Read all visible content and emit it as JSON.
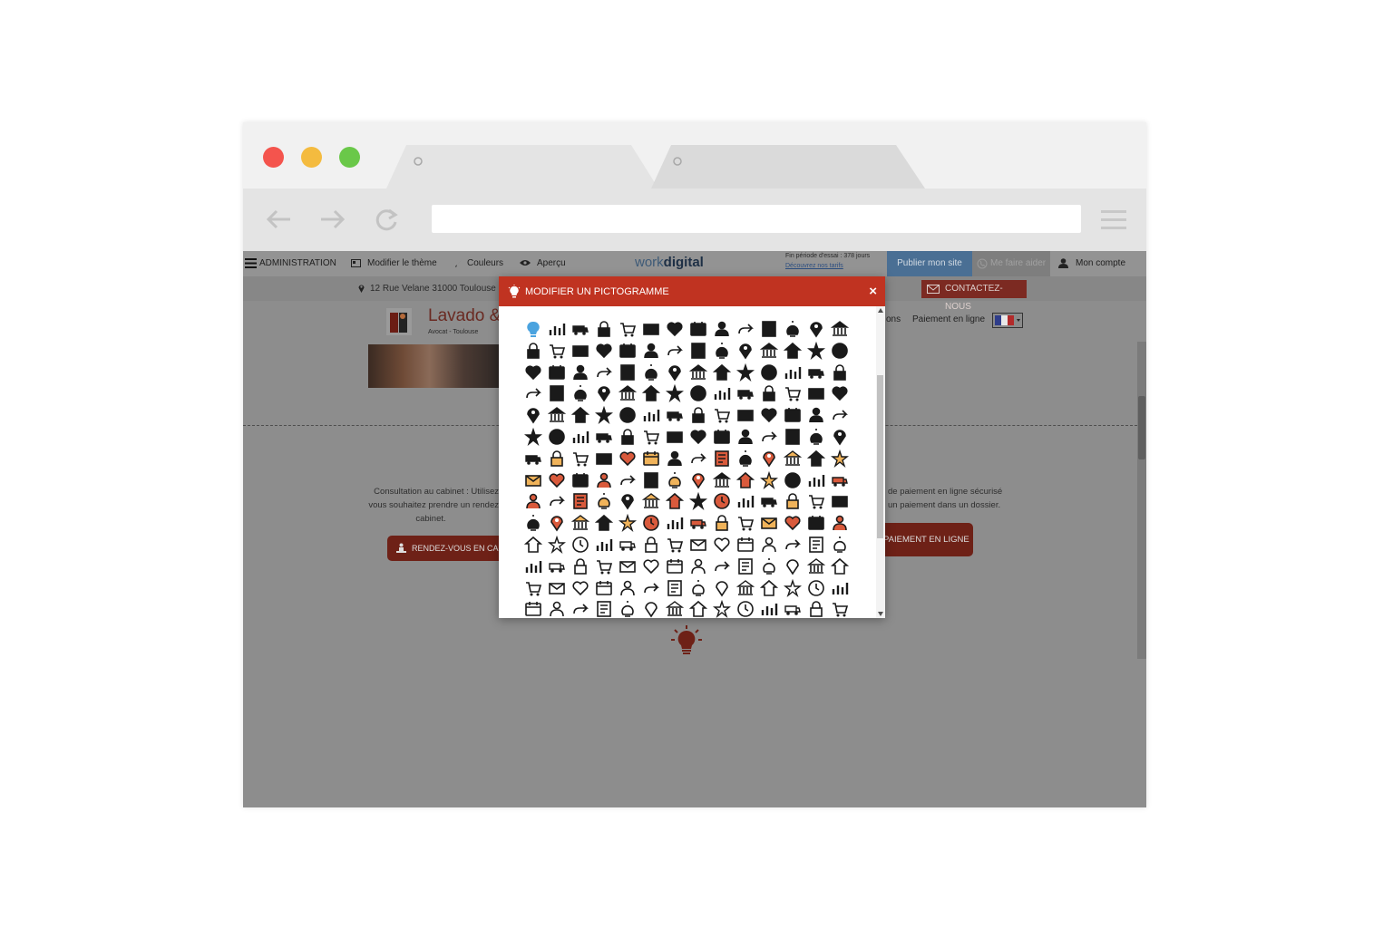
{
  "admin_bar": {
    "administration": "ADMINISTRATION",
    "modify_theme": "Modifier le thème",
    "colors": "Couleurs",
    "preview": "Aperçu",
    "logo_work": "work",
    "logo_digital": "digital",
    "trial_end": "Fin période d'essai : 378 jours",
    "discover_prices": "Découvrez nos tarifs",
    "publish": "Publier mon site",
    "help": "Me faire aider",
    "account": "Mon compte"
  },
  "site": {
    "address": "12 Rue Velane 31000 Toulouse",
    "contact": "CONTACTEZ-NOUS",
    "title": "Lavado &",
    "subtitle": "Avocat - Toulouse",
    "nav_partial": "ons",
    "nav_payment": "Paiement en ligne",
    "text_left": [
      "Consultation au cabinet : Utilisez",
      "vous souhaitez prendre un rendez",
      "cabinet."
    ],
    "text_right": [
      "de paiement en ligne sécurisé",
      "un paiement dans un dossier."
    ],
    "btn_appointment": "RENDEZ-VOUS EN CA",
    "btn_payment": "PAIEMENT EN LIGNE"
  },
  "modal": {
    "title": "MODIFIER UN PICTOGRAMME",
    "close": "×",
    "icon_rows": 14,
    "icon_cols": 14,
    "selected_icon": "lightbulb-icon"
  },
  "colors": {
    "modal_header": "#c03321",
    "icon_dark": "#1a1a1a",
    "icon_accent": "#d95a3c",
    "publish_button": "#4a6f94"
  }
}
